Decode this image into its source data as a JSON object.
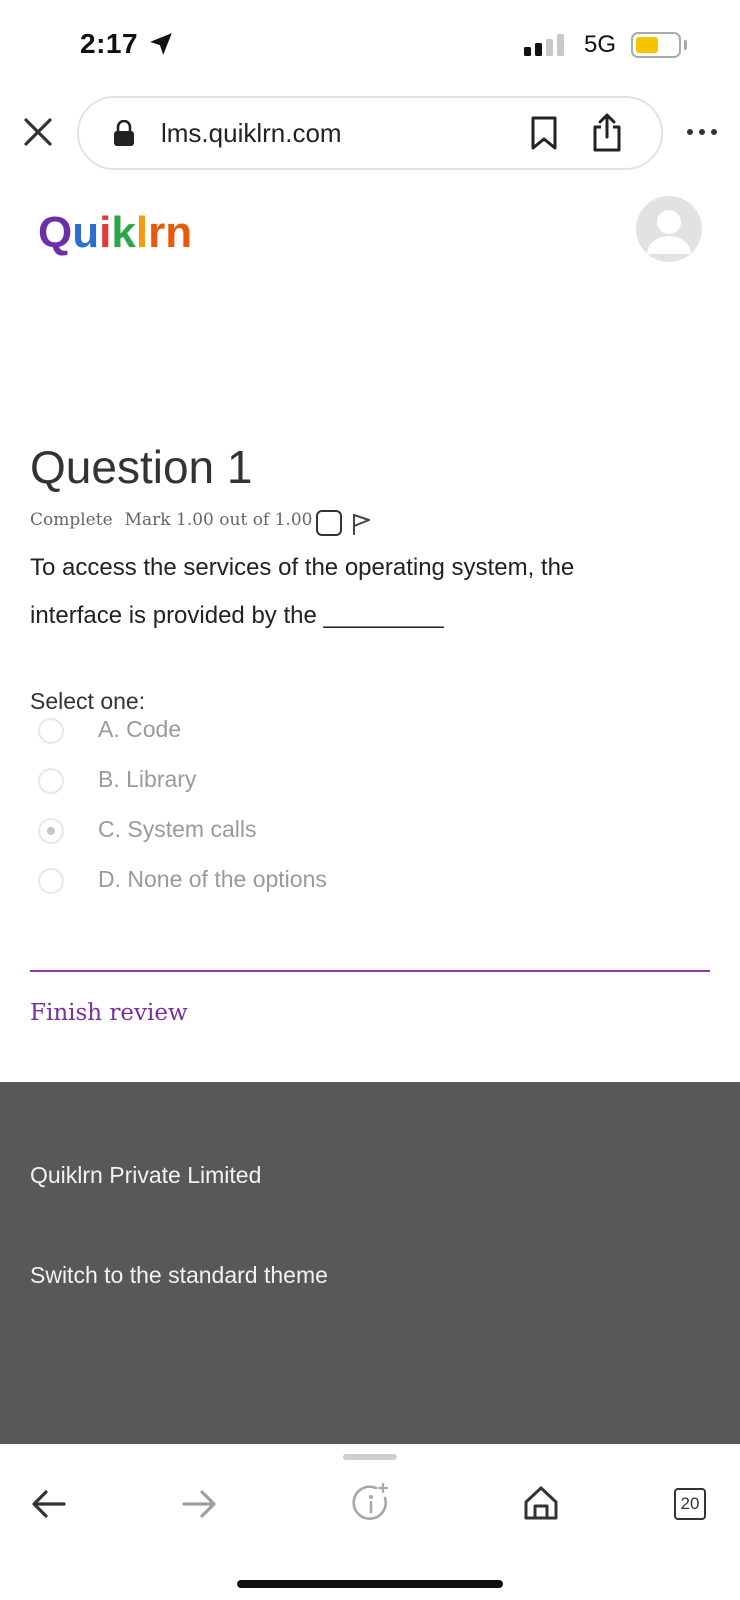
{
  "status_bar": {
    "time": "2:17",
    "network": "5G",
    "battery_level": 0.55,
    "battery_color": "#f5c400"
  },
  "browser": {
    "url": "lms.quiklrn.com",
    "icons": [
      "close-icon",
      "lock-icon",
      "bookmark-icon",
      "share-icon",
      "more-icon"
    ]
  },
  "site": {
    "logo_letters": [
      "Q",
      "u",
      "i",
      "k",
      "l",
      "r",
      "n"
    ],
    "logo_colors": [
      "#6b2fa8",
      "#2c6fd1",
      "#e53935",
      "#2ca64b",
      "#f39c12",
      "#e8590c"
    ]
  },
  "question": {
    "title": "Question 1",
    "state": "Complete",
    "mark": "Mark 1.00 out of 1.00",
    "text_line1": "To access the services of the operating system, the",
    "text_line2": "interface is provided by the _________",
    "select_label": "Select one:",
    "options": [
      {
        "label": "A. Code",
        "selected": false
      },
      {
        "label": "B. Library",
        "selected": false
      },
      {
        "label": "C. System calls",
        "selected": true
      },
      {
        "label": "D. None of the options",
        "selected": false
      }
    ],
    "finish_label": "Finish review"
  },
  "footer": {
    "company": "Quiklrn Private Limited",
    "theme_link": "Switch to the standard theme"
  },
  "toolbar": {
    "tabs_count": "20"
  },
  "colors": {
    "accent_purple": "#7b2e9e",
    "footer_bg": "#585858"
  }
}
